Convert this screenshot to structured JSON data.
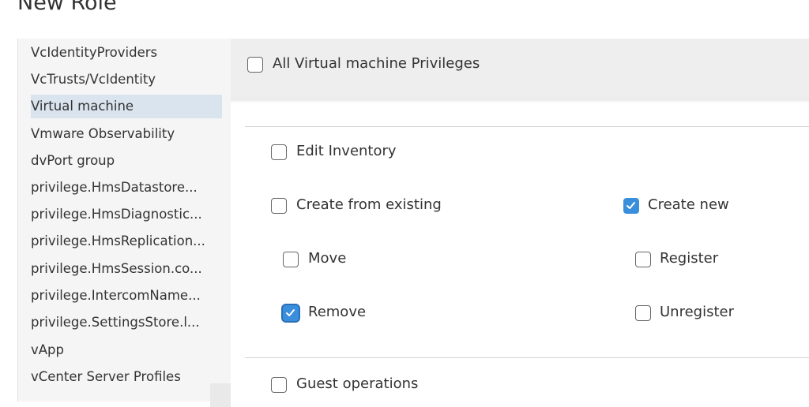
{
  "page": {
    "title": "New Role"
  },
  "sidebar": {
    "items": [
      {
        "label": "VcIdentityProviders",
        "selected": false
      },
      {
        "label": "VcTrusts/VcIdentity",
        "selected": false
      },
      {
        "label": "Virtual machine",
        "selected": true
      },
      {
        "label": "Vmware Observability",
        "selected": false
      },
      {
        "label": "dvPort group",
        "selected": false
      },
      {
        "label": "privilege.HmsDatastore...",
        "selected": false
      },
      {
        "label": "privilege.HmsDiagnostic...",
        "selected": false
      },
      {
        "label": "privilege.HmsReplication...",
        "selected": false
      },
      {
        "label": "privilege.HmsSession.co...",
        "selected": false
      },
      {
        "label": "privilege.IntercomName...",
        "selected": false
      },
      {
        "label": "privilege.SettingsStore.l...",
        "selected": false
      },
      {
        "label": "vApp",
        "selected": false
      },
      {
        "label": "vCenter Server Profiles",
        "selected": false
      }
    ]
  },
  "main": {
    "all_privileges": {
      "label": "All Virtual machine Privileges",
      "checked": false
    },
    "privileges": {
      "edit_inventory": {
        "label": "Edit Inventory",
        "checked": false
      },
      "create_from_existing": {
        "label": "Create from existing",
        "checked": false
      },
      "create_new": {
        "label": "Create new",
        "checked": true
      },
      "move": {
        "label": "Move",
        "checked": false
      },
      "register": {
        "label": "Register",
        "checked": false
      },
      "remove": {
        "label": "Remove",
        "checked": true
      },
      "unregister": {
        "label": "Unregister",
        "checked": false
      },
      "guest_operations": {
        "label": "Guest operations",
        "checked": false
      }
    }
  },
  "colors": {
    "accent": "#3a8fdd",
    "selected_bg": "#d9e4ee",
    "header_bg": "#eeeeee"
  }
}
